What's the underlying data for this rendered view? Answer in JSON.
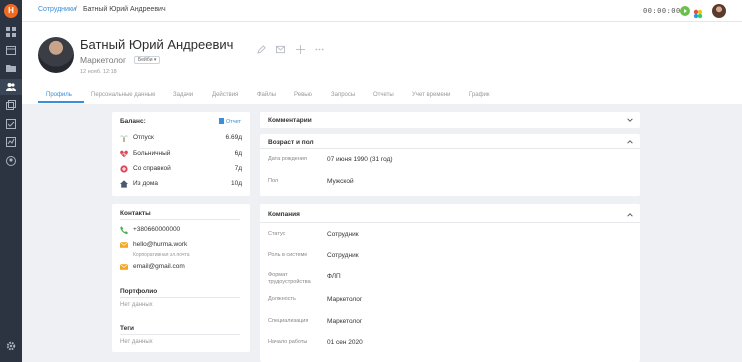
{
  "breadcrumb": {
    "root": "Сотрудники",
    "separator": "/",
    "current": "Батный Юрий Андреевич"
  },
  "topbar": {
    "timer": "00:00:00"
  },
  "profile": {
    "name": "Батный Юрий Андреевич",
    "position": "Маркетолог",
    "status_badge": "Бейби ▾",
    "last_seen": "12 нояб. 12:18"
  },
  "tabs": [
    "Профиль",
    "Персональные данные",
    "Задачи",
    "Действия",
    "Файлы",
    "Ревью",
    "Запросы",
    "Отчеты",
    "Учет времени",
    "График"
  ],
  "balance": {
    "title": "Баланс:",
    "report_link": "Отчет",
    "rows": [
      {
        "icon": "palm-tree-icon",
        "label": "Отпуск",
        "value": "6.69д"
      },
      {
        "icon": "heart-icon",
        "label": "Больничный",
        "value": "6д"
      },
      {
        "icon": "medkit-icon",
        "label": "Со справкой",
        "value": "7д"
      },
      {
        "icon": "home-icon",
        "label": "Из дома",
        "value": "10д"
      }
    ]
  },
  "contacts": {
    "title": "Контакты",
    "phone": "+380660000000",
    "email_work": "hello@hurma.work",
    "email_work_note": "Корпоративная эл.почта",
    "email_personal": "email@gmail.com",
    "portfolio_title": "Портфолио",
    "portfolio_value": "Нет данных",
    "tags_title": "Теги",
    "tags_value": "Нет данных"
  },
  "sections": {
    "comments_title": "Комментарии",
    "age_title": "Возраст и пол",
    "birth_label": "Дата рождения",
    "birth_value": "07 июня 1990 (31 год)",
    "sex_label": "Пол",
    "sex_value": "Мужской",
    "company_title": "Компания",
    "company_fields": [
      {
        "label": "Статус",
        "value": "Сотрудник"
      },
      {
        "label": "Роль в системе",
        "value": "Сотрудник"
      },
      {
        "label": "Формат трудоустройства",
        "value": "ФЛП"
      },
      {
        "label": "Должность",
        "value": "Маркетолог"
      },
      {
        "label": "Специализация",
        "value": "Маркетолог"
      },
      {
        "label": "Начало работы",
        "value": "01 сен 2020"
      }
    ]
  },
  "colors": {
    "accent": "#3a8fd9",
    "brand": "#f26a21",
    "sidebar": "#2b3440"
  }
}
